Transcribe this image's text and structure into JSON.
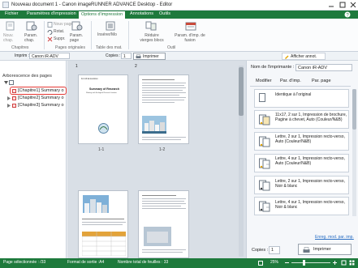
{
  "window": {
    "title": "Nouveau document 1 - Canon imageRUNNER ADVANCE Desktop - Editor",
    "controls": [
      "minimize-icon",
      "maximize-icon",
      "close-icon"
    ]
  },
  "ribbon_tabs": [
    {
      "label": "Fichier"
    },
    {
      "label": "Paramètres d'impression"
    },
    {
      "label": "Options d'impression"
    },
    {
      "label": "Annotations"
    },
    {
      "label": "Outils"
    }
  ],
  "ribbon": {
    "groups": {
      "chapitres": "Chapitres",
      "pages_originales": "Pages originales",
      "table_mat": "Table des mat.",
      "outil": "Outil"
    },
    "buttons": {
      "nouv_chap": "Nouv. chap.",
      "param_chap": "Param. chap.",
      "nouv_page": "Nouv page",
      "rotat": "Rotat.",
      "suppr": "Suppr.",
      "param_page": "Param. page",
      "inserer_mo": "Insérer/Mo",
      "reduire_vierges": "Réduire vierges blocs",
      "param_fusion": "Param. d'imp. de fusion"
    }
  },
  "printbar": {
    "imprimer_label": "Imprim :",
    "printer_value": "Canon iR-ADV",
    "copies_label": "Copies :",
    "copies_value": "1",
    "print_button": "Imprimer",
    "afficher_annot": "Afficher annot."
  },
  "left_panel": {
    "title": "Arborescence des pages",
    "items": [
      {
        "label": "[Chapitre1] Summary o",
        "selected": true
      },
      {
        "label": "[Chapitre2] Summary o",
        "selected": false
      },
      {
        "label": "[Chapitre3] Summary o",
        "selected": false
      }
    ]
  },
  "canvas": {
    "chapter_numbers": [
      "1",
      "2"
    ],
    "page_labels": [
      "1-1",
      "1-2"
    ],
    "page1": {
      "header": "For All Ecosolution",
      "title": "Summary of Research",
      "subtitle": "Working with Ecological Research Institute"
    }
  },
  "right_panel": {
    "printer_label": "Nom de l'imprimante :",
    "printer_value": "Canon iR-ADV",
    "tabs": [
      "Modifier",
      "Par. d'imp.",
      "Par. page"
    ],
    "settings": [
      {
        "text": "Identique à l'original"
      },
      {
        "text": "11x17, 2 sur 1, Impression de brochure, Pagine à chevet, Auto (Couleur/N&B)"
      },
      {
        "text": "Lettre, 2 sur 1, Impression recto-verso, Auto (Couleur/N&B)"
      },
      {
        "text": "Lettre, 4 sur 1, Impression recto-verso, Auto (Couleur/N&B)"
      },
      {
        "text": "Lettre, 2 sur 1, Impression recto-verso, Noir & blanc"
      },
      {
        "text": "Lettre, 4 sur 1, Impression recto-verso, Noir & blanc"
      }
    ],
    "link": "Enreg. mod. par. imp.",
    "copies_label": "Copies :",
    "copies_value": "1",
    "print_button": "Imprimer"
  },
  "statusbar": {
    "selected": "Page sélectionnée : /33",
    "format": "Format de sortie :A4",
    "sheets": "Nombre total de feuilles : 33",
    "zoom": "25%"
  },
  "colors": {
    "accent": "#1e7a3c",
    "selection_outline": "#e53935"
  }
}
